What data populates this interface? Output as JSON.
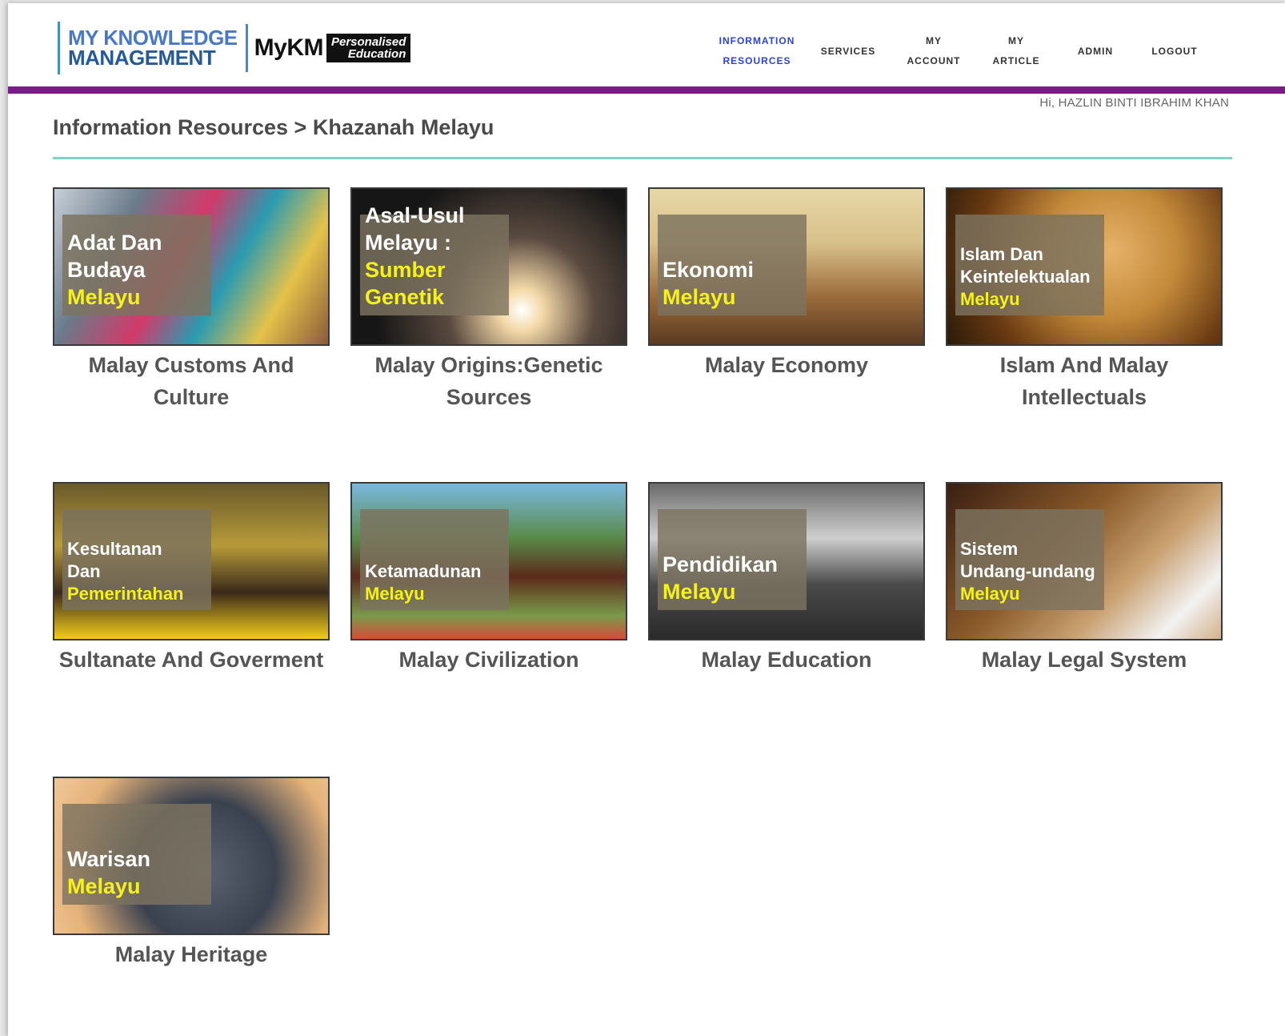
{
  "header": {
    "logo": {
      "line1": "MY KNOWLEDGE",
      "line2": "MANAGEMENT",
      "brand": "MyKM",
      "badge_line1": "Personalised",
      "badge_line2": "Education"
    },
    "nav": [
      {
        "label": "INFORMATION\nRESOURCES",
        "active": true
      },
      {
        "label": "SERVICES",
        "active": false
      },
      {
        "label": "MY\nACCOUNT",
        "active": false
      },
      {
        "label": "MY\nARTICLE",
        "active": false
      },
      {
        "label": "ADMIN",
        "active": false
      },
      {
        "label": "LOGOUT",
        "active": false
      }
    ],
    "greeting": "Hi, HAZLIN BINTI IBRAHIM KHAN"
  },
  "breadcrumb": "Information Resources > Khazanah Melayu",
  "cards": [
    {
      "overlay_white": "Adat Dan\nBudaya",
      "overlay_yellow": "Melayu",
      "caption": "Malay Customs And Culture"
    },
    {
      "overlay_white": "Asal-Usul\nMelayu :",
      "overlay_yellow": "Sumber\nGenetik",
      "caption": "Malay Origins:Genetic Sources"
    },
    {
      "overlay_white": "Ekonomi",
      "overlay_yellow": "Melayu",
      "caption": "Malay Economy"
    },
    {
      "overlay_white": "Islam Dan\nKeintelektualan",
      "overlay_yellow": "Melayu",
      "caption": "Islam And Malay Intellectuals"
    },
    {
      "overlay_white": "Kesultanan\nDan",
      "overlay_yellow": "Pemerintahan",
      "caption": "Sultanate And Goverment"
    },
    {
      "overlay_white": "Ketamadunan",
      "overlay_yellow": "Melayu",
      "caption": "Malay Civilization"
    },
    {
      "overlay_white": "Pendidikan",
      "overlay_yellow": "Melayu",
      "caption": "Malay Education"
    },
    {
      "overlay_white": "Sistem\nUndang-undang",
      "overlay_yellow": "Melayu",
      "caption": "Malay Legal System"
    },
    {
      "overlay_white": "Warisan",
      "overlay_yellow": "Melayu",
      "caption": "Malay Heritage"
    }
  ],
  "colors": {
    "accent_bar": "#7a1a8c",
    "nav_active": "#2b43d6",
    "divider": "#7dd4c5",
    "overlay_highlight": "#f5f219"
  }
}
